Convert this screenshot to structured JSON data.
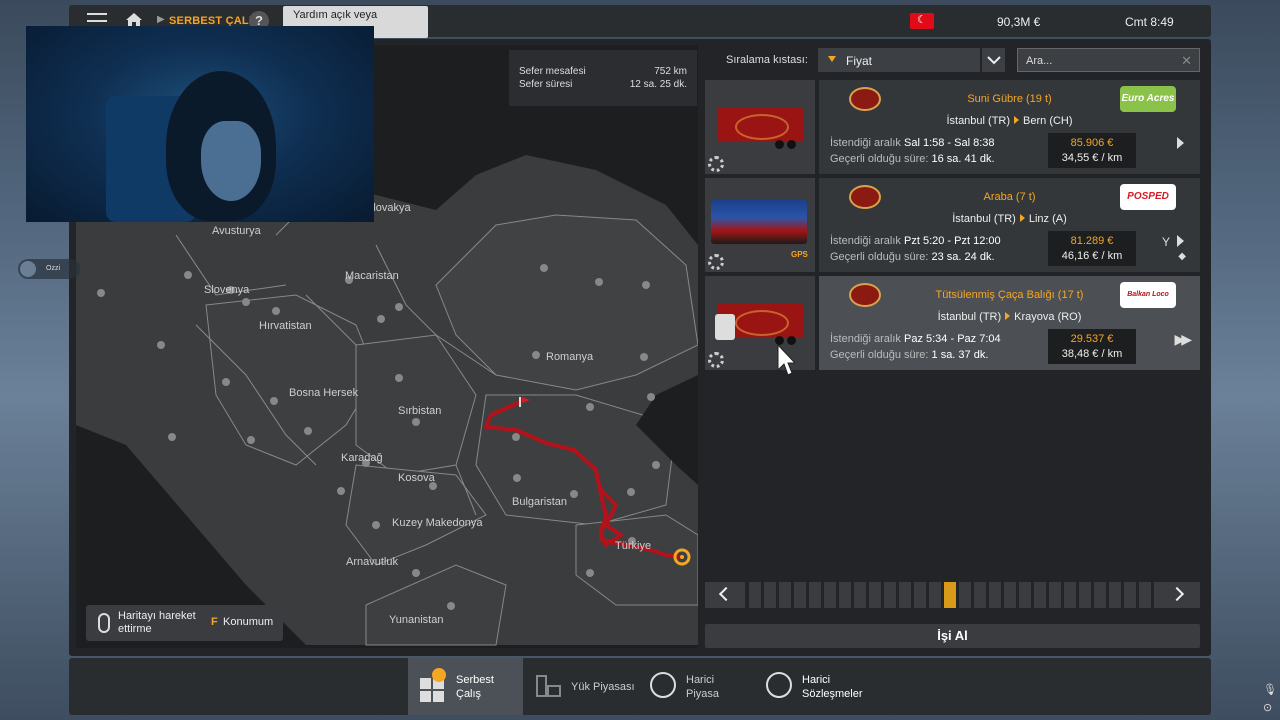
{
  "topbar": {
    "breadcrumb": "SERBEST ÇALIŞ",
    "help_symbol": "?",
    "help_tooltip": "Yardım açık veya",
    "money": "90,3M  €",
    "clock": "Cmt 8:49"
  },
  "map": {
    "info": {
      "distance_label": "Sefer mesafesi",
      "distance_value": "752 km",
      "duration_label": "Sefer süresi",
      "duration_value": "12 sa. 25 dk."
    },
    "countries": {
      "slovakya": "Slovakya",
      "avusturya": "Avusturya",
      "macaristan": "Macaristan",
      "slovenya": "Slovenya",
      "hirvatistan": "Hırvatistan",
      "romanya": "Romanya",
      "bosna": "Bosna Hersek",
      "sirbistan": "Sırbistan",
      "karadag": "Karadağ",
      "kosova": "Kosova",
      "bulgaristan": "Bulgaristan",
      "makedonya": "Kuzey Makedonya",
      "turkiye": "Türkiye",
      "arnavutluk": "Arnavutluk",
      "yunanistan": "Yunanistan"
    },
    "hint": {
      "move_text": "Haritayı hareket ettirme",
      "location_key": "F",
      "location_text": "Konumum"
    }
  },
  "filters": {
    "sort_label": "Sıralama kıstası:",
    "sort_value": "Fiyat",
    "search_placeholder": "Ara..."
  },
  "jobs": [
    {
      "cargo": "Suni Gübre (19 t)",
      "from": "İstanbul (TR)",
      "to": "Bern (CH)",
      "window_label": "İstendiği aralık",
      "window_value": "Sal 1:58 - Sal 8:38",
      "valid_label": "Geçerli olduğu süre:",
      "valid_value": "16 sa. 41 dk.",
      "price": "85.906 €",
      "per_km": "34,55 € / km",
      "dest_company": "Euro Acres"
    },
    {
      "cargo": "Araba (7 t)",
      "from": "İstanbul (TR)",
      "to": "Linz (A)",
      "window_label": "İstendiği aralık",
      "window_value": "Pzt 5:20 - Pzt 12:00",
      "valid_label": "Geçerli olduğu süre:",
      "valid_value": "23 sa. 24 dk.",
      "price": "81.289 €",
      "per_km": "46,16 € / km",
      "dest_company": "POSPED",
      "gps": "GPS"
    },
    {
      "cargo": "Tütsülenmiş Çaça Balığı (17 t)",
      "from": "İstanbul (TR)",
      "to": "Krayova (RO)",
      "window_label": "İstendiği aralık",
      "window_value": "Paz 5:34 - Paz 7:04",
      "valid_label": "Geçerli olduğu süre:",
      "valid_value": "1 sa. 37 dk.",
      "price": "29.537 €",
      "per_km": "38,48 € / km",
      "dest_company": "Balkan Loco"
    }
  ],
  "pager": {
    "active_page": 14,
    "pages": 28
  },
  "accept_label": "İşi Al",
  "bottom_tabs": [
    {
      "label1": "Serbest",
      "label2": "Çalış"
    },
    {
      "label1": "Yük Piyasası",
      "label2": ""
    },
    {
      "label1": "Harici",
      "label2": "Piyasa"
    },
    {
      "label1": "Harici",
      "label2": "Sözleşmeler"
    }
  ],
  "side_badge": "Ozzi",
  "colors": {
    "accent": "#f5a623",
    "route": "#b3121b",
    "panel": "#222427"
  }
}
